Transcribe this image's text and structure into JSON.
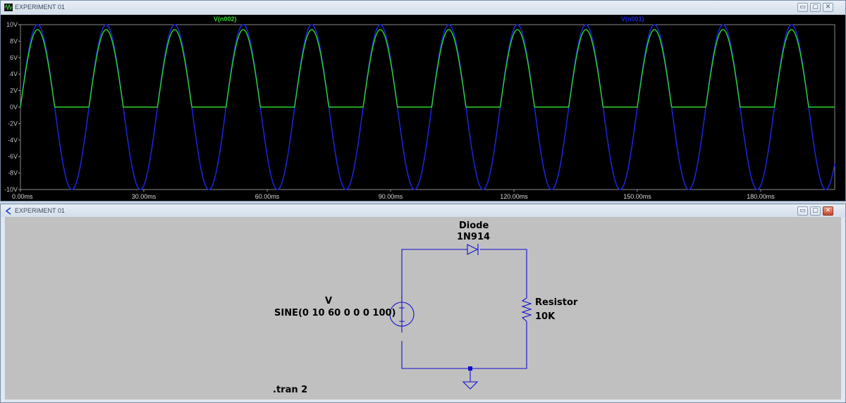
{
  "plot_window": {
    "title": "EXPERIMENT 01",
    "controls": [
      "minimize",
      "maximize",
      "close"
    ]
  },
  "schematic_window": {
    "title": "EXPERIMENT 01",
    "controls": [
      "minimize",
      "maximize",
      "close"
    ]
  },
  "chart_data": {
    "type": "line",
    "title": "",
    "xlabel": "",
    "ylabel": "",
    "xlim": [
      0,
      198
    ],
    "ylim": [
      -10,
      10
    ],
    "y_ticks": [
      "10V",
      "8V",
      "6V",
      "4V",
      "2V",
      "0V",
      "-2V",
      "-4V",
      "-6V",
      "-8V",
      "-10V"
    ],
    "x_ticks": [
      "0.00ms",
      "30.00ms",
      "60.00ms",
      "90.00ms",
      "120.00ms",
      "150.00ms",
      "180.00ms"
    ],
    "grid": false,
    "background": "#000000",
    "series": [
      {
        "name": "V(n002)",
        "color": "#2bd52b",
        "amplitude": 9.4,
        "frequency_hz": 60,
        "clipped_below": 0
      },
      {
        "name": "V(n001)",
        "color": "#1a24d6",
        "amplitude": 10,
        "frequency_hz": 60
      }
    ]
  },
  "schematic": {
    "source": {
      "name": "V",
      "value": "SINE(0 10 60 0 0 0 100)"
    },
    "diode": {
      "name": "Diode",
      "value": "1N914"
    },
    "resistor": {
      "name": "Resistor",
      "value": "10K"
    },
    "directive": ".tran 2",
    "wire_color": "#1010d0"
  }
}
